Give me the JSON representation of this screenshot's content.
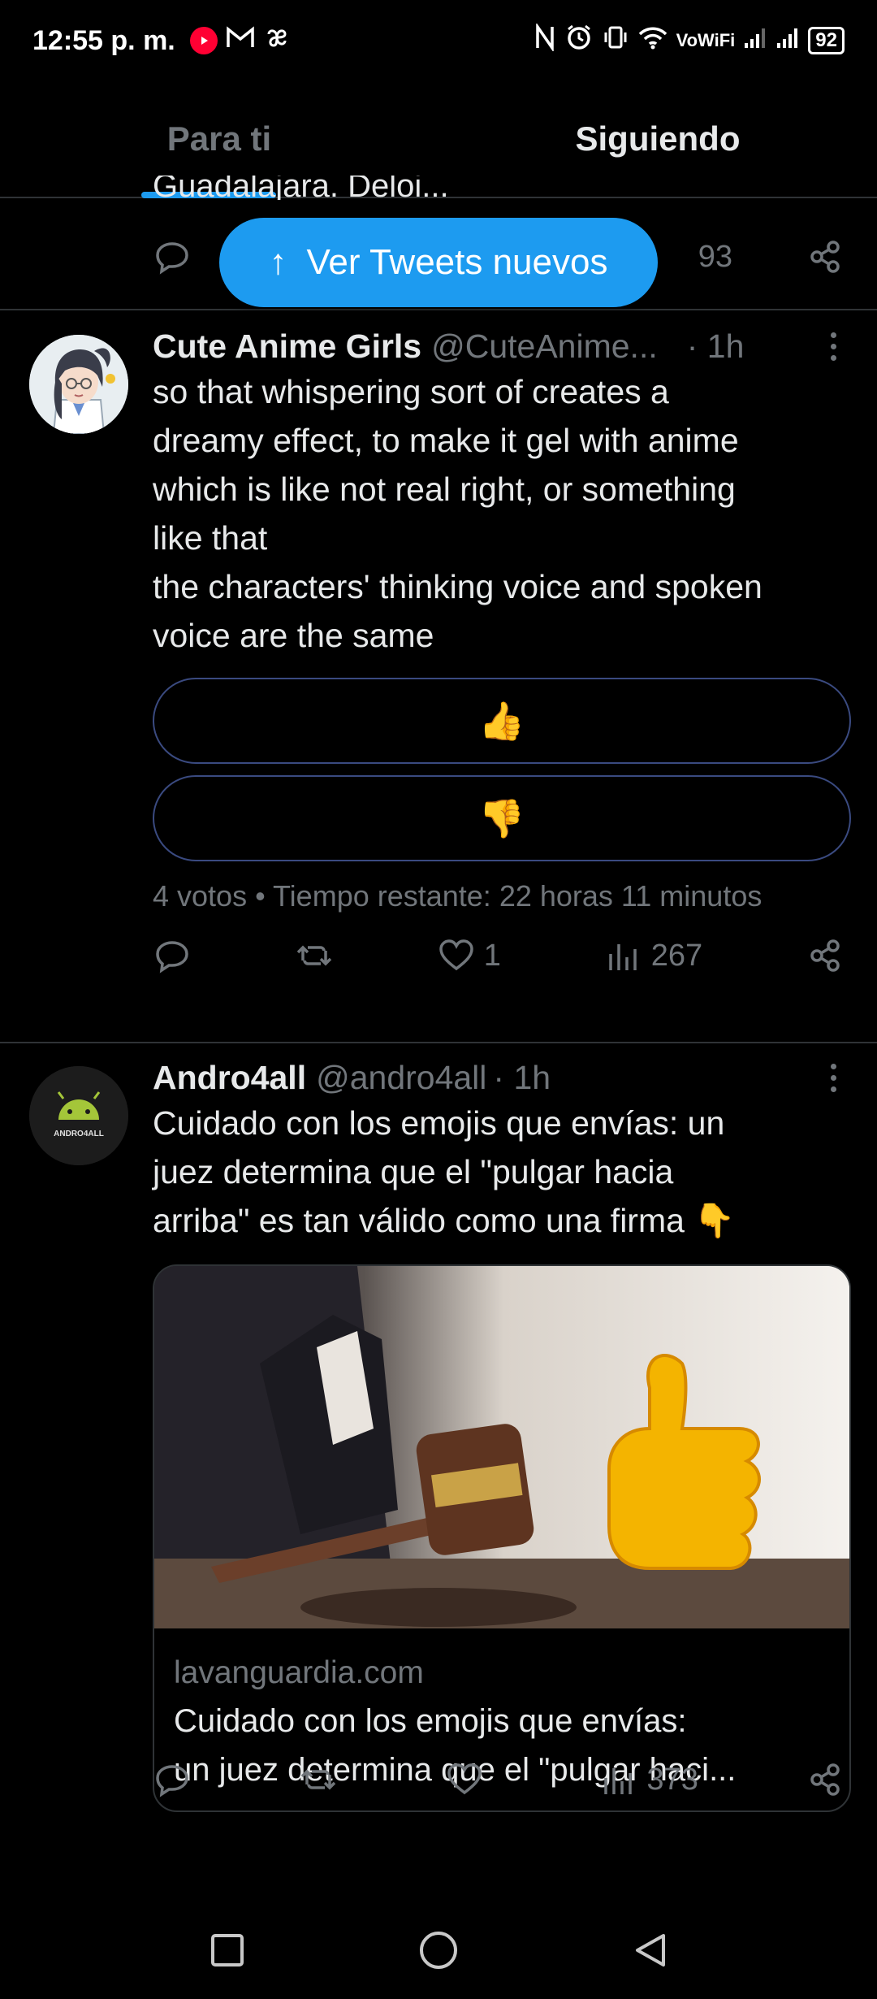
{
  "status_bar": {
    "time": "12:55 p. m.",
    "carrier_text": "VoWiFi",
    "battery": "92"
  },
  "tabs": [
    {
      "label": "Para ti",
      "active": false
    },
    {
      "label": "Siguiendo",
      "active": true
    }
  ],
  "partial_tweet": {
    "text_fragment": "Guadalajara. Deloi...",
    "views": "93"
  },
  "new_tweets_button": {
    "label": "Ver Tweets nuevos"
  },
  "tweets": [
    {
      "name": "Cute Anime Girls",
      "handle": "@CuteAnime...",
      "time": "· 1h",
      "text_lines": [
        "so that whispering sort of creates a",
        "dreamy effect, to make it gel with anime",
        "which is like not real right, or something",
        "like that",
        "the characters' thinking voice and spoken",
        "voice are the same"
      ],
      "poll": {
        "options": [
          "👍",
          "👎"
        ],
        "meta": "4 votos • Tiempo restante: 22 horas 11 minutos"
      },
      "likes": "1",
      "views": "267"
    },
    {
      "name": "Andro4all",
      "handle": "@andro4all",
      "time": "· 1h",
      "avatar_text": "ANDRO4ALL",
      "text_lines": [
        "Cuidado con los emojis que envías: un",
        "juez determina que el \"pulgar hacia",
        "arriba\" es tan válido como una firma 👇"
      ],
      "card": {
        "domain": "lavanguardia.com",
        "title_lines": [
          "Cuidado con los emojis que envías:",
          "un juez determina que el \"pulgar haci..."
        ]
      },
      "likes": "",
      "views": "373"
    }
  ],
  "colors": {
    "background": "#000000",
    "accent": "#1d9bf0",
    "text_primary": "#e7e9ea",
    "text_secondary": "#71767b",
    "divider": "#2f3336"
  }
}
